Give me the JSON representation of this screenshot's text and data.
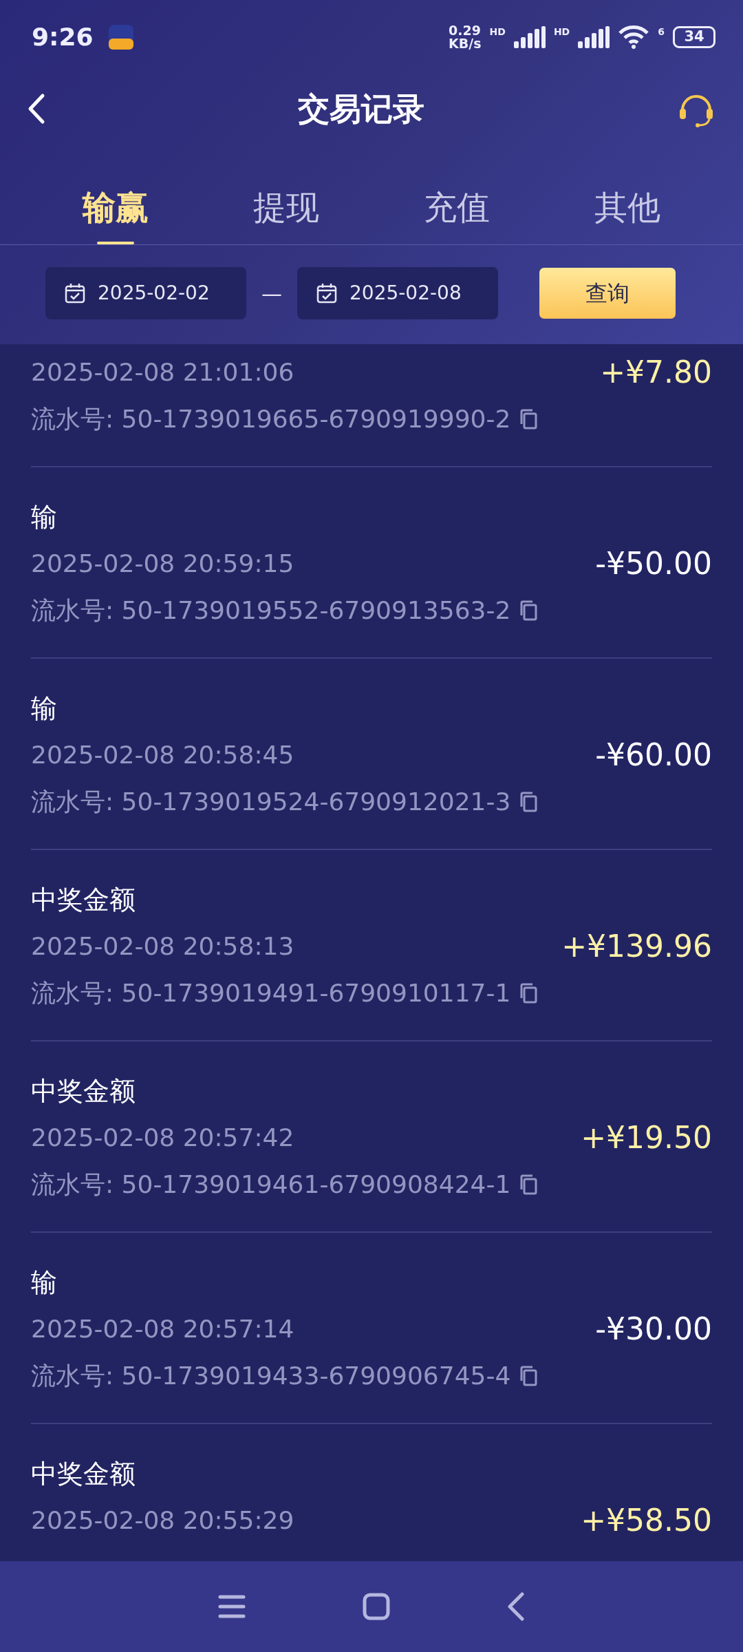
{
  "status_bar": {
    "time": "9:26",
    "net_speed": [
      "0.29",
      "KB/s"
    ],
    "sim_labels": [
      "HD",
      "HD"
    ],
    "wifi_label": "6",
    "battery": "34"
  },
  "header": {
    "title": "交易记录"
  },
  "tabs": [
    {
      "label": "输赢",
      "selected": true
    },
    {
      "label": "提现",
      "selected": false
    },
    {
      "label": "充值",
      "selected": false
    },
    {
      "label": "其他",
      "selected": false
    }
  ],
  "filter": {
    "start_date": "2025-02-02",
    "separator": "—",
    "end_date": "2025-02-08",
    "button": "查询"
  },
  "records": [
    {
      "date": "2025-02-08 21:01:06",
      "serial": "流水号: 50-1739019665-6790919990-2",
      "amount": "+¥7.80",
      "kind": "gain"
    },
    {
      "title": "输",
      "date": "2025-02-08 20:59:15",
      "serial": "流水号: 50-1739019552-6790913563-2",
      "amount": "-¥50.00",
      "kind": "loss"
    },
    {
      "title": "输",
      "date": "2025-02-08 20:58:45",
      "serial": "流水号: 50-1739019524-6790912021-3",
      "amount": "-¥60.00",
      "kind": "loss"
    },
    {
      "title": "中奖金额",
      "date": "2025-02-08 20:58:13",
      "serial": "流水号: 50-1739019491-6790910117-1",
      "amount": "+¥139.96",
      "kind": "gain"
    },
    {
      "title": "中奖金额",
      "date": "2025-02-08 20:57:42",
      "serial": "流水号: 50-1739019461-6790908424-1",
      "amount": "+¥19.50",
      "kind": "gain"
    },
    {
      "title": "输",
      "date": "2025-02-08 20:57:14",
      "serial": "流水号: 50-1739019433-6790906745-4",
      "amount": "-¥30.00",
      "kind": "loss"
    },
    {
      "title": "中奖金额",
      "date": "2025-02-08 20:55:29",
      "amount": "+¥58.50",
      "kind": "gain"
    }
  ]
}
